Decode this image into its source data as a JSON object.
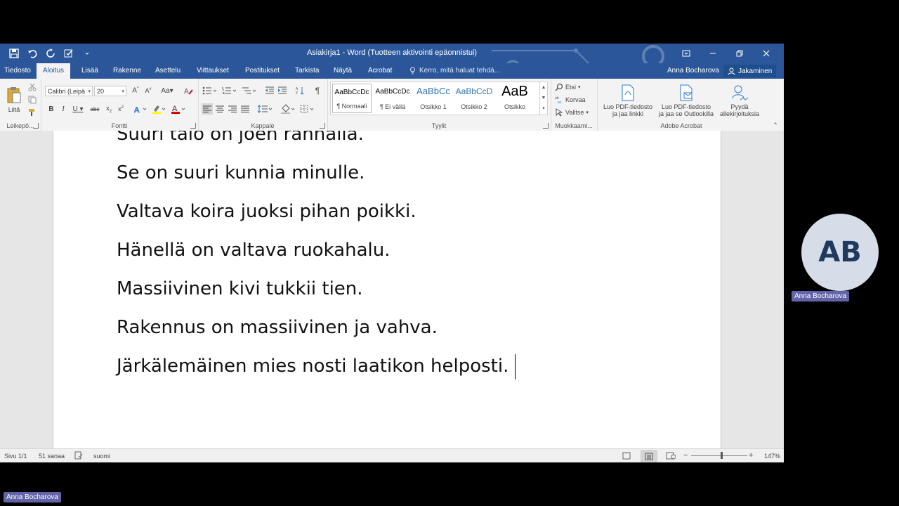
{
  "window": {
    "title": "Asiakirja1 - Word (Tuotteen aktivointi epäonnistui)"
  },
  "tabs": [
    {
      "label": "Tiedosto"
    },
    {
      "label": "Aloitus",
      "active": true
    },
    {
      "label": "Lisää"
    },
    {
      "label": "Rakenne"
    },
    {
      "label": "Asettelu"
    },
    {
      "label": "Viittaukset"
    },
    {
      "label": "Postitukset"
    },
    {
      "label": "Tarkista"
    },
    {
      "label": "Näytä"
    },
    {
      "label": "Acrobat"
    }
  ],
  "tell_me": "Kerro, mitä haluat tehdä...",
  "account": {
    "user_name": "Anna Bocharova",
    "share_label": "Jakaminen"
  },
  "ribbon": {
    "clipboard": {
      "paste_label": "Liitä",
      "group_label": "Leikepö..."
    },
    "font": {
      "font_name": "Calibri (Leipä",
      "font_size": "20",
      "group_label": "Fontti"
    },
    "paragraph": {
      "group_label": "Kappale"
    },
    "styles": {
      "group_label": "Tyylit",
      "items": [
        {
          "sample": "AaBbCcDc",
          "name": "¶ Normaali"
        },
        {
          "sample": "AaBbCcDc",
          "name": "¶ Ei väliä"
        },
        {
          "sample": "AaBbCc",
          "name": "Otsikko 1"
        },
        {
          "sample": "AaBbCcD",
          "name": "Otsikko 2"
        },
        {
          "sample": "AaB",
          "name": "Otsikko"
        }
      ]
    },
    "editing": {
      "find": "Etsi",
      "replace": "Korvaa",
      "select": "Valitse",
      "group_label": "Muokkaami..."
    },
    "acrobat": {
      "group_label": "Adobe Acrobat",
      "btn1_line1": "Luo PDF-tiedosto",
      "btn1_line2": "ja jaa linkki",
      "btn2_line1": "Luo PDF-tiedosto",
      "btn2_line2": "ja jaa se Outlookilla",
      "btn3_line1": "Pyydä",
      "btn3_line2": "allekirjoituksia"
    }
  },
  "document": {
    "lines": [
      "Suuri talo on joen rannalla.",
      "Se on suuri kunnia minulle.",
      "Valtava koira juoksi pihan poikki.",
      "Hänellä on valtava ruokahalu.",
      "Massiivinen kivi tukkii tien.",
      "Rakennus on massiivinen ja vahva.",
      "Järkälemäinen mies nosti laatikon helposti."
    ]
  },
  "status": {
    "page": "Sivu 1/1",
    "words": "51 sanaa",
    "language": "suomi",
    "zoom": "147%"
  },
  "participant": {
    "initials": "AB",
    "name": "Anna Bocharova"
  },
  "colors": {
    "word_blue": "#2b579a",
    "teams_purple": "#6264a7"
  }
}
